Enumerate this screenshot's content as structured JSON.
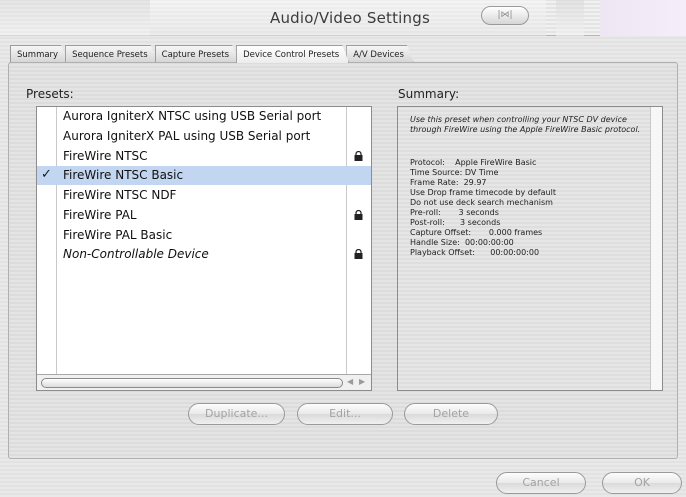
{
  "window": {
    "title": "Audio/Video Settings",
    "toolbar_pill_label": "|⋈|"
  },
  "tabs": [
    {
      "label": "Summary"
    },
    {
      "label": "Sequence Presets"
    },
    {
      "label": "Capture Presets"
    },
    {
      "label": "Device Control Presets",
      "active": true
    },
    {
      "label": "A/V Devices"
    }
  ],
  "presets": {
    "label": "Presets:",
    "items": [
      {
        "label": "Aurora IgniterX NTSC using USB Serial port",
        "locked": false,
        "selected": false,
        "italic": false
      },
      {
        "label": "Aurora IgniterX PAL using USB Serial port",
        "locked": false,
        "selected": false,
        "italic": false
      },
      {
        "label": "FireWire NTSC",
        "locked": true,
        "selected": false,
        "italic": false
      },
      {
        "label": "FireWire NTSC Basic",
        "locked": false,
        "selected": true,
        "italic": false
      },
      {
        "label": "FireWire NTSC NDF",
        "locked": false,
        "selected": false,
        "italic": false
      },
      {
        "label": "FireWire PAL",
        "locked": true,
        "selected": false,
        "italic": false
      },
      {
        "label": "FireWire PAL Basic",
        "locked": false,
        "selected": false,
        "italic": false
      },
      {
        "label": "Non-Controllable Device",
        "locked": true,
        "selected": false,
        "italic": true
      }
    ],
    "checkmark": "✓"
  },
  "summary": {
    "label": "Summary:",
    "description": "Use this preset when controlling your NTSC DV device through FireWire using the Apple FireWire Basic protocol.",
    "lines": [
      "Protocol:    Apple FireWire Basic",
      "Time Source: DV Time",
      "Frame Rate:  29.97",
      "Use Drop frame timecode by default",
      "Do not use deck search mechanism",
      "Pre-roll:       3 seconds",
      "Post-roll:      3 seconds",
      "Capture Offset:       0.000 frames",
      "Handle Size:  00:00:00:00",
      "Playback Offset:      00:00:00:00"
    ]
  },
  "buttons": {
    "duplicate": "Duplicate...",
    "edit": "Edit...",
    "delete": "Delete",
    "cancel": "Cancel",
    "ok": "OK"
  }
}
